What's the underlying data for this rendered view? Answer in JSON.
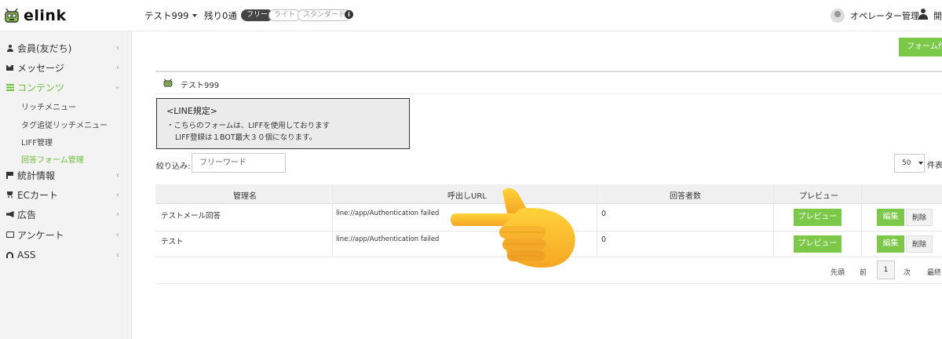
{
  "header": {
    "logo_text": "elink",
    "bot_name": "テスト999",
    "remaining": "残り0通",
    "plans": [
      "フリー",
      "ライト",
      "スタンダード"
    ],
    "operator_label": "オペレーター管理",
    "user_name": "開"
  },
  "sidebar": {
    "items": [
      {
        "label": "会員(友だち)",
        "icon": "user-icon"
      },
      {
        "label": "メッセージ",
        "icon": "envelope-icon"
      },
      {
        "label": "コンテンツ",
        "icon": "list-icon"
      },
      {
        "label": "統計情報",
        "icon": "flag-icon"
      },
      {
        "label": "ECカート",
        "icon": "cart-icon"
      },
      {
        "label": "広告",
        "icon": "bullhorn-icon"
      },
      {
        "label": "アンケート",
        "icon": "survey-icon"
      },
      {
        "label": "ASS",
        "icon": "headset-icon"
      }
    ],
    "sub_items": [
      "リッチメニュー",
      "タグ追従リッチメニュー",
      "LIFF管理",
      "回答フォーム管理"
    ],
    "active_item": "コンテンツ",
    "active_sub_item": "回答フォーム管理"
  },
  "main": {
    "create_button": "フォーム作成",
    "card_title": "テスト999",
    "rule": {
      "title": "<LINE規定>",
      "line1": "・こちらのフォームは、LIFFを使用しております",
      "line2": "LIFF登録は１BOT最大３０個になります。"
    },
    "filter": {
      "label": "絞り込み:",
      "placeholder": "フリーワード"
    },
    "per_page": {
      "value": "50",
      "label": "件表示"
    },
    "table": {
      "headers": [
        "管理名",
        "呼出しURL",
        "回答者数",
        "プレビュー"
      ],
      "rows": [
        {
          "name": "テストメール回答",
          "url": "line://app/Authentication failed",
          "count": "0"
        },
        {
          "name": "テスト",
          "url": "line://app/Authentication failed",
          "count": "0"
        }
      ],
      "preview_label": "プレビュー",
      "edit_label": "編集",
      "delete_label": "削除"
    },
    "pagination": {
      "first": "先頭",
      "prev": "前",
      "current": "1",
      "next": "次",
      "last": "最終"
    }
  },
  "colors": {
    "accent": "#7cc94a",
    "active_text": "#6bbf3a",
    "sidebar_bg": "#f3f3f3"
  }
}
